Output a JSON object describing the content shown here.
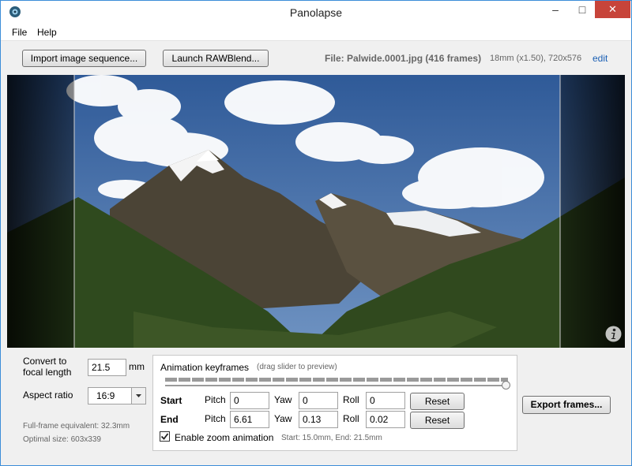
{
  "window": {
    "title": "Panolapse",
    "min_glyph": "–",
    "max_glyph": "□",
    "close_glyph": "✕"
  },
  "menu": {
    "file": "File",
    "help": "Help"
  },
  "toolbar": {
    "import_label": "Import image sequence...",
    "raw_label": "Launch RAWBlend...",
    "file_info": "File: Palwide.0001.jpg (416 frames)",
    "lens_info": "18mm (x1.50), 720x576",
    "edit_label": "edit"
  },
  "settings": {
    "convert_label_line1": "Convert to",
    "convert_label_line2": "focal length",
    "focal_value": "21.5",
    "focal_unit": "mm",
    "aspect_label": "Aspect ratio",
    "aspect_value": "16:9",
    "fullframe_text": "Full-frame equivalent: 32.3mm",
    "optimal_text": "Optimal size: 603x339"
  },
  "keyframes": {
    "title": "Animation keyframes",
    "hint": "(drag slider to preview)",
    "start_label": "Start",
    "end_label": "End",
    "pitch_label": "Pitch",
    "yaw_label": "Yaw",
    "roll_label": "Roll",
    "start": {
      "pitch": "0",
      "yaw": "0",
      "roll": "0"
    },
    "end": {
      "pitch": "6.61",
      "yaw": "0.13",
      "roll": "0.02"
    },
    "reset_label": "Reset",
    "zoom_label": "Enable zoom animation",
    "zoom_checked": true,
    "zoom_info": "Start: 15.0mm, End: 21.5mm"
  },
  "export_label": "Export frames...",
  "icons": [
    "app-icon",
    "info-icon",
    "checkmark-icon",
    "chevron-down-icon"
  ],
  "colors": {
    "accent": "#1a5fb4",
    "close": "#c7443a",
    "window_border": "#3c8dd8"
  }
}
